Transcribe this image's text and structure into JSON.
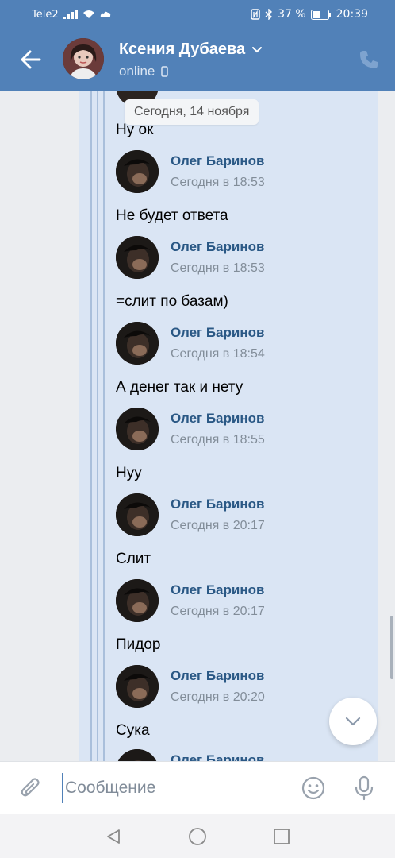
{
  "status_bar": {
    "carrier": "Tele2",
    "battery_percent": "37 %",
    "time": "20:39"
  },
  "header": {
    "contact_name": "Ксения Дубаева",
    "status": "online"
  },
  "chat": {
    "date_label": "Сегодня, 14 ноября",
    "messages": [
      {
        "author": "Олег Баринов",
        "time": "Сегодня в 18:53",
        "text": "Не будет ответа"
      },
      {
        "author": "Олег Баринов",
        "time": "Сегодня в 18:53",
        "text": "=слит по базам)"
      },
      {
        "author": "Олег Баринов",
        "time": "Сегодня в 18:54",
        "text": "А денег так и нету"
      },
      {
        "author": "Олег Баринов",
        "time": "Сегодня в 18:55",
        "text": "Нуу"
      },
      {
        "author": "Олег Баринов",
        "time": "Сегодня в 20:17",
        "text": "Слит"
      },
      {
        "author": "Олег Баринов",
        "time": "Сегодня в 20:17",
        "text": "Пидор"
      },
      {
        "author": "Олег Баринов",
        "time": "Сегодня в 20:20",
        "text": "Сука"
      },
      {
        "author": "Олег Баринов",
        "time": "",
        "text": ""
      }
    ],
    "first_text": "Ну ок"
  },
  "composer": {
    "placeholder": "Сообщение"
  },
  "colors": {
    "header_bg": "#5181b8",
    "forward_bg": "#dae5f4",
    "author_name": "#2a5885"
  },
  "icons": [
    "back-arrow-icon",
    "chevron-down-icon",
    "mobile-icon",
    "phone-icon",
    "attach-icon",
    "emoji-icon",
    "mic-icon",
    "chevron-down-icon",
    "nav-back-icon",
    "nav-home-icon",
    "nav-recents-icon"
  ]
}
